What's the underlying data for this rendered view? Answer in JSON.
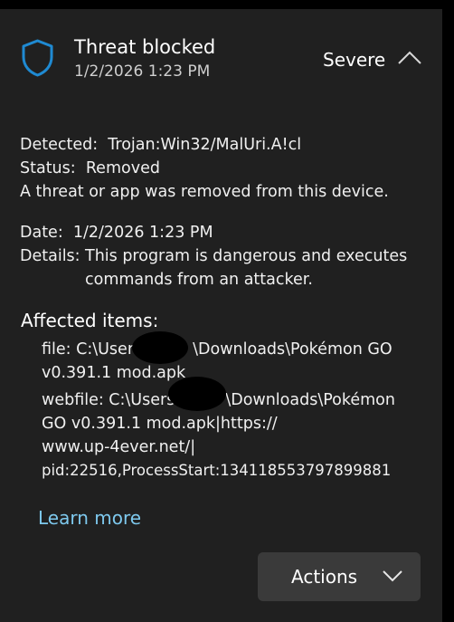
{
  "header": {
    "title": "Threat blocked",
    "date": "1/2/2026 1:23 PM",
    "severity": "Severe",
    "icon": "shield-icon",
    "expanded": true
  },
  "info": {
    "detected_label": "Detected:",
    "detected_value": "Trojan:Win32/MalUri.A!cl",
    "status_label": "Status:",
    "status_value": "Removed",
    "status_message": "A threat or app was removed from this device.",
    "date_label": "Date:",
    "date_value": "1/2/2026 1:23 PM",
    "details_label": "Details:",
    "details_value": "This program is dangerous and executes commands from an attacker."
  },
  "affected": {
    "heading": "Affected items:",
    "items": [
      {
        "line1_prefix": "file: C:\\Users",
        "line1_suffix": "\\Downloads\\Pokémon GO",
        "line2": "v0.391.1 mod.apk"
      },
      {
        "line1_prefix": "webfile: C:\\Users",
        "line1_suffix": "\\Downloads\\Pokémon",
        "line2": "GO v0.391.1 mod.apk|https://",
        "line3": "www.up-4ever.net/|",
        "line4": "pid:22516,ProcessStart:134118553797899881"
      }
    ]
  },
  "learn_more": "Learn more",
  "actions_label": "Actions",
  "colors": {
    "background": "#202020",
    "accent": "#1f8ad2",
    "link": "#7ec9ee",
    "button": "#3a3a3a"
  }
}
